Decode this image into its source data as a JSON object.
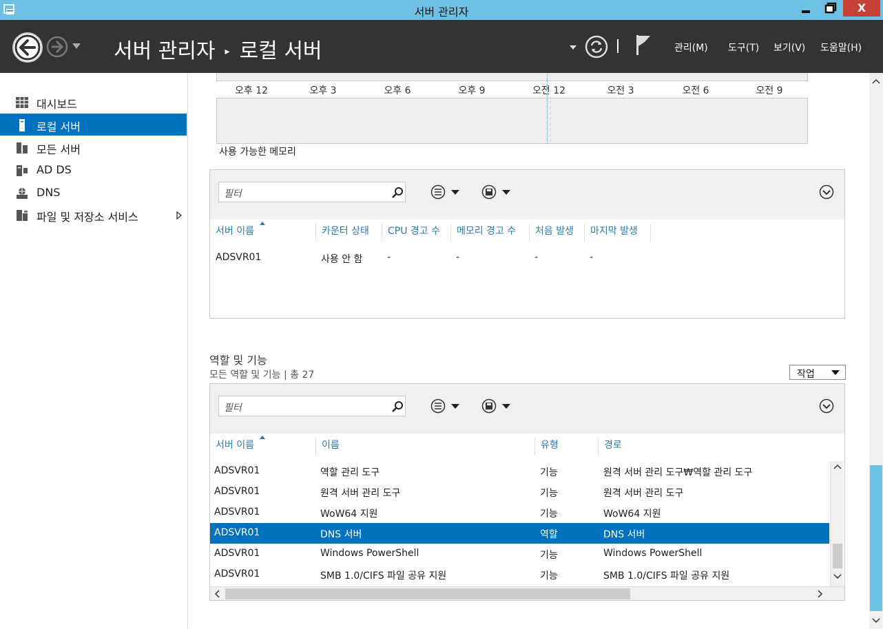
{
  "window": {
    "title": "서버 관리자",
    "minimize": "▬",
    "maximize": "❐",
    "close": "X"
  },
  "header": {
    "breadcrumb_root": "서버 관리자",
    "breadcrumb_sep": "▸",
    "breadcrumb_current": "로컬 서버",
    "menus": [
      "관리(M)",
      "도구(T)",
      "보기(V)",
      "도움말(H)"
    ]
  },
  "sidebar": {
    "items": [
      {
        "label": "대시보드",
        "icon": "dashboard-icon"
      },
      {
        "label": "로컬 서버",
        "icon": "local-server-icon",
        "active": true
      },
      {
        "label": "모든 서버",
        "icon": "all-servers-icon"
      },
      {
        "label": "AD DS",
        "icon": "ad-ds-icon"
      },
      {
        "label": "DNS",
        "icon": "dns-icon"
      },
      {
        "label": "파일 및 저장소 서비스",
        "icon": "file-storage-icon",
        "has_submenu": true
      }
    ]
  },
  "chart": {
    "ticks": [
      "오후 12",
      "오후 3",
      "오후 6",
      "오후 9",
      "오전 12",
      "오전 3",
      "오전 6",
      "오전 9"
    ],
    "label": "사용 가능한 메모리"
  },
  "perf_panel": {
    "filter_placeholder": "필터",
    "columns": [
      "서버 이름",
      "카운터 상태",
      "CPU 경고 수",
      "메모리 경고 수",
      "처음 발생",
      "마지막 발생"
    ],
    "rows": [
      {
        "server": "ADSVR01",
        "counter": "사용 안 함",
        "cpu": "-",
        "mem": "-",
        "first": "-",
        "last": "-"
      }
    ]
  },
  "roles": {
    "title": "역할 및 기능",
    "subtitle": "모든 역할 및 기능 | 총 27",
    "tasks_label": "작업",
    "filter_placeholder": "필터",
    "columns": [
      "서버 이름",
      "이름",
      "유형",
      "경로"
    ],
    "rows": [
      {
        "server": "ADSVR01",
        "name": "역할 관리 도구",
        "type": "기능",
        "path": "원격 서버 관리 도구₩역할 관리 도구"
      },
      {
        "server": "ADSVR01",
        "name": "원격 서버 관리 도구",
        "type": "기능",
        "path": "원격 서버 관리 도구"
      },
      {
        "server": "ADSVR01",
        "name": "WoW64 지원",
        "type": "기능",
        "path": "WoW64 지원"
      },
      {
        "server": "ADSVR01",
        "name": "DNS 서버",
        "type": "역할",
        "path": "DNS 서버",
        "selected": true
      },
      {
        "server": "ADSVR01",
        "name": "Windows PowerShell",
        "type": "기능",
        "path": "Windows PowerShell"
      },
      {
        "server": "ADSVR01",
        "name": "SMB 1.0/CIFS 파일 공유 지원",
        "type": "기능",
        "path": "SMB 1.0/CIFS 파일 공유 지원"
      }
    ]
  },
  "colors": {
    "titlebar": "#6ec1e4",
    "header": "#333333",
    "accent": "#0071bc",
    "close": "#c74137",
    "link": "#2a7ab0"
  }
}
